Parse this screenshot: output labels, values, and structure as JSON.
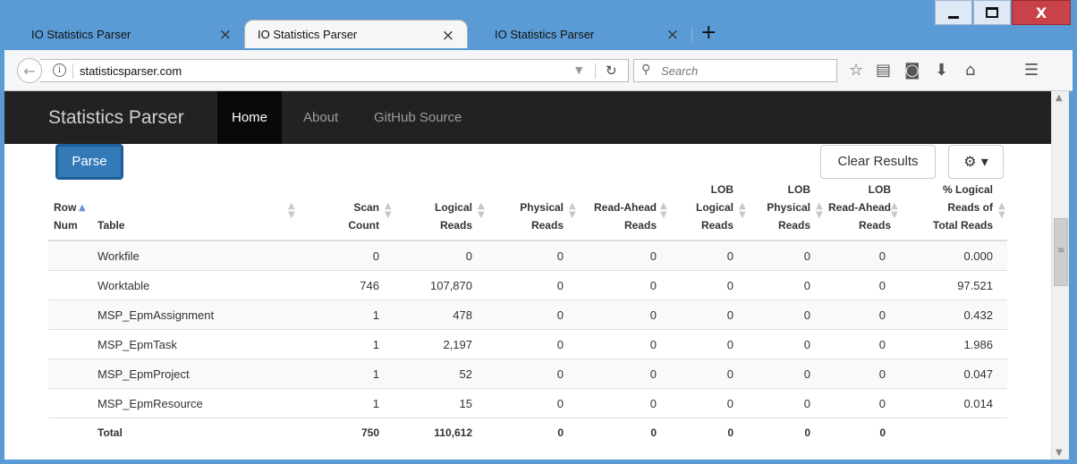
{
  "browser": {
    "tabs": [
      {
        "title": "IO Statistics Parser",
        "active": false
      },
      {
        "title": "IO Statistics Parser",
        "active": true
      },
      {
        "title": "IO Statistics Parser",
        "active": false
      }
    ],
    "new_tab_glyph": "+",
    "close_glyph": "×",
    "url": "statisticsparser.com",
    "search_placeholder": "Search",
    "window_close_glyph": "X"
  },
  "site": {
    "brand": "Statistics Parser",
    "nav": [
      {
        "label": "Home",
        "active": true
      },
      {
        "label": "About",
        "active": false
      },
      {
        "label": "GitHub Source",
        "active": false
      }
    ],
    "parse_label": "Parse",
    "clear_label": "Clear Results",
    "settings_glyph": "⚙ ▾"
  },
  "table": {
    "headers": {
      "row_num": [
        "Row",
        "Num"
      ],
      "table": [
        "Table"
      ],
      "scan_count": [
        "Scan",
        "Count"
      ],
      "logical_reads": [
        "Logical",
        "Reads"
      ],
      "physical_reads": [
        "Physical",
        "Reads"
      ],
      "read_ahead_reads": [
        "Read-Ahead",
        "Reads"
      ],
      "lob_logical_reads": [
        "LOB",
        "Logical",
        "Reads"
      ],
      "lob_physical_reads": [
        "LOB",
        "Physical",
        "Reads"
      ],
      "lob_read_ahead_reads": [
        "LOB",
        "Read-Ahead",
        "Reads"
      ],
      "pct_logical": [
        "% Logical",
        "Reads of",
        "Total Reads"
      ]
    },
    "rows": [
      {
        "table": "Workfile",
        "scan": "0",
        "logical": "0",
        "physical": "0",
        "readahead": "0",
        "lob_logical": "0",
        "lob_physical": "0",
        "lob_readahead": "0",
        "pct": "0.000"
      },
      {
        "table": "Worktable",
        "scan": "746",
        "logical": "107,870",
        "physical": "0",
        "readahead": "0",
        "lob_logical": "0",
        "lob_physical": "0",
        "lob_readahead": "0",
        "pct": "97.521"
      },
      {
        "table": "MSP_EpmAssignment",
        "scan": "1",
        "logical": "478",
        "physical": "0",
        "readahead": "0",
        "lob_logical": "0",
        "lob_physical": "0",
        "lob_readahead": "0",
        "pct": "0.432"
      },
      {
        "table": "MSP_EpmTask",
        "scan": "1",
        "logical": "2,197",
        "physical": "0",
        "readahead": "0",
        "lob_logical": "0",
        "lob_physical": "0",
        "lob_readahead": "0",
        "pct": "1.986"
      },
      {
        "table": "MSP_EpmProject",
        "scan": "1",
        "logical": "52",
        "physical": "0",
        "readahead": "0",
        "lob_logical": "0",
        "lob_physical": "0",
        "lob_readahead": "0",
        "pct": "0.047"
      },
      {
        "table": "MSP_EpmResource",
        "scan": "1",
        "logical": "15",
        "physical": "0",
        "readahead": "0",
        "lob_logical": "0",
        "lob_physical": "0",
        "lob_readahead": "0",
        "pct": "0.014"
      }
    ],
    "total": {
      "table": "Total",
      "scan": "750",
      "logical": "110,612",
      "physical": "0",
      "readahead": "0",
      "lob_logical": "0",
      "lob_physical": "0",
      "lob_readahead": "0",
      "pct": ""
    }
  }
}
